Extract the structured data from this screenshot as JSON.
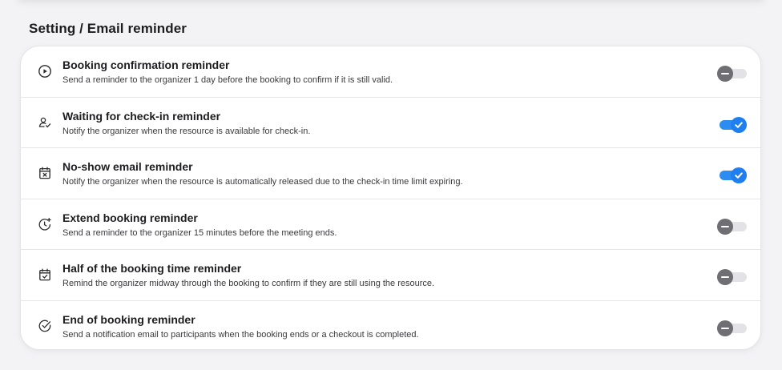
{
  "header": {
    "title": "Setting / Email reminder"
  },
  "reminders": [
    {
      "icon": "play-circle-icon",
      "title": "Booking confirmation reminder",
      "description": "Send a reminder to the organizer 1 day before the booking to confirm if it is still valid.",
      "enabled": false
    },
    {
      "icon": "user-check-icon",
      "title": "Waiting for check-in reminder",
      "description": "Notify the organizer when the resource is available for check-in.",
      "enabled": true
    },
    {
      "icon": "calendar-x-icon",
      "title": "No-show email reminder",
      "description": "Notify the organizer when the resource is automatically released due to the check-in time limit expiring.",
      "enabled": true
    },
    {
      "icon": "clock-plus-icon",
      "title": "Extend booking reminder",
      "description": "Send a reminder to the organizer 15 minutes before the meeting ends.",
      "enabled": false
    },
    {
      "icon": "calendar-check-icon",
      "title": "Half of the booking time reminder",
      "description": "Remind the organizer midway through the booking to confirm if they are still using the resource.",
      "enabled": false
    },
    {
      "icon": "check-circle-icon",
      "title": "End of booking reminder",
      "description": "Send a notification email to participants when the booking ends or a checkout is completed.",
      "enabled": false
    }
  ],
  "colors": {
    "toggle_on": "#1f7ef0",
    "toggle_off": "#6e6e73",
    "background": "#f3f3f5"
  }
}
